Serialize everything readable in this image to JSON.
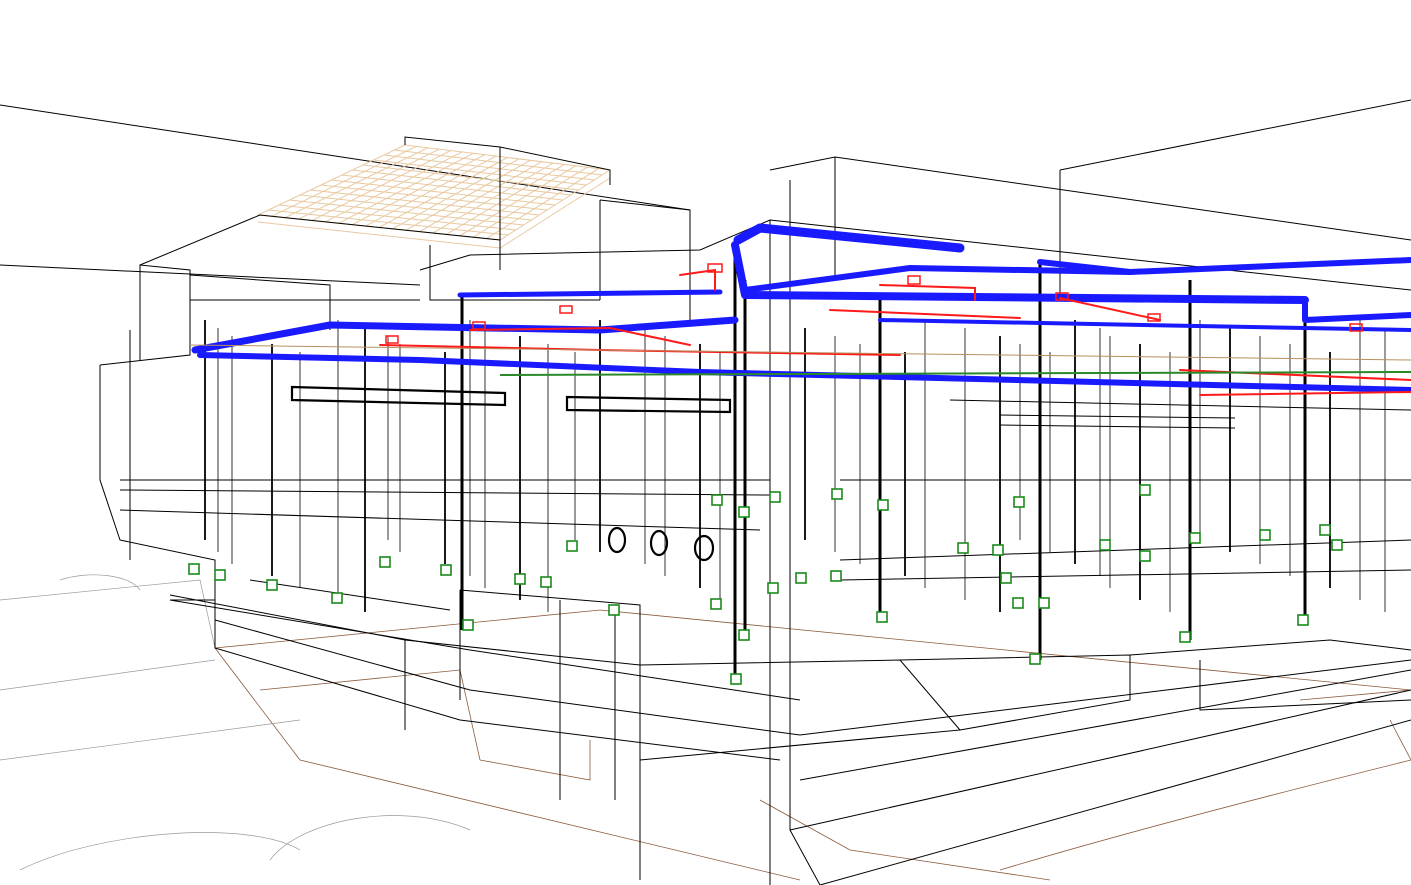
{
  "viewport": {
    "view_mode": "3D wireframe",
    "colors": {
      "background": "#ffffff",
      "structure": "#000000",
      "supply_duct": "#1a1aff",
      "piping": "#ff1a1a",
      "fixtures": "#1a8a1a",
      "roof_grid": "#e8c9a0",
      "site_lines": "#8b5a3c"
    },
    "layers": [
      {
        "name": "structure-wireframe",
        "icon": "wireframe-box-icon"
      },
      {
        "name": "columns",
        "icon": "column-icon"
      },
      {
        "name": "supply-duct",
        "icon": "duct-icon"
      },
      {
        "name": "piping",
        "icon": "pipe-icon"
      },
      {
        "name": "fixtures",
        "icon": "fixture-icon"
      },
      {
        "name": "roof-grid",
        "icon": "roof-grid-icon"
      },
      {
        "name": "site-outline",
        "icon": "site-icon"
      }
    ]
  }
}
